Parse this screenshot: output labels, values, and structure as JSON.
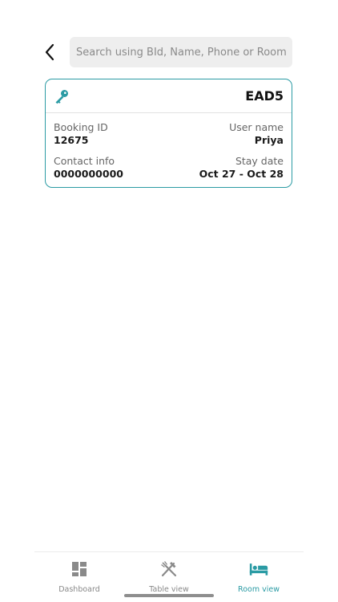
{
  "search": {
    "placeholder": "Search using BId, Name, Phone or Room Id"
  },
  "booking_card": {
    "room_id": "EAD5",
    "booking_id_label": "Booking ID",
    "booking_id_value": "12675",
    "user_name_label": "User name",
    "user_name_value": "Priya",
    "contact_label": "Contact info",
    "contact_value": "0000000000",
    "stay_date_label": "Stay date",
    "stay_date_value": "Oct 27 - Oct 28",
    "icon": "key-icon"
  },
  "nav": {
    "items": [
      {
        "label": "Dashboard",
        "icon": "dashboard-icon",
        "active": false
      },
      {
        "label": "Table view",
        "icon": "fork-knife-icon",
        "active": false
      },
      {
        "label": "Room view",
        "icon": "bed-icon",
        "active": true
      }
    ]
  },
  "colors": {
    "accent": "#2b9ba4",
    "inactive": "#888888",
    "search_bg": "#eeeeee"
  }
}
